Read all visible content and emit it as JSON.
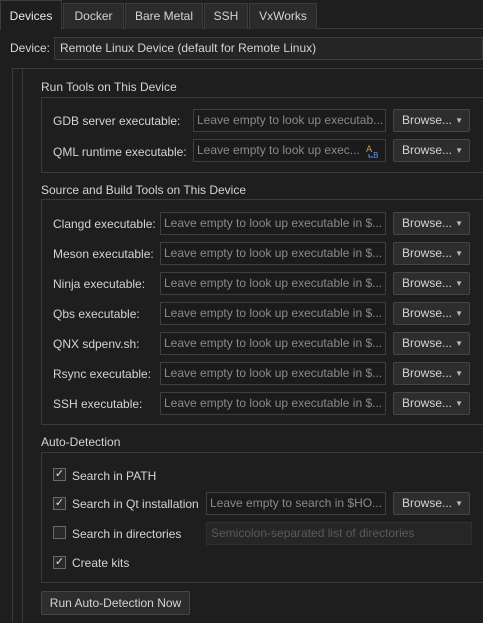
{
  "tabs": [
    {
      "label": "Devices"
    },
    {
      "label": "Docker"
    },
    {
      "label": "Bare Metal"
    },
    {
      "label": "SSH"
    },
    {
      "label": "VxWorks"
    }
  ],
  "device": {
    "label": "Device:",
    "value": "Remote Linux Device (default for Remote Linux)"
  },
  "run_tools": {
    "title": "Run Tools on This Device",
    "rows": [
      {
        "label": "GDB server executable:",
        "placeholder": "Leave empty to look up executab...",
        "browse": "Browse..."
      },
      {
        "label": "QML runtime executable:",
        "placeholder": "Leave empty to look up exec...",
        "browse": "Browse..."
      }
    ]
  },
  "source_tools": {
    "title": "Source and Build Tools on This Device",
    "rows": [
      {
        "label": "Clangd executable:",
        "placeholder": "Leave empty to look up executable in $...",
        "browse": "Browse..."
      },
      {
        "label": "Meson executable:",
        "placeholder": "Leave empty to look up executable in $...",
        "browse": "Browse..."
      },
      {
        "label": "Ninja executable:",
        "placeholder": "Leave empty to look up executable in $...",
        "browse": "Browse..."
      },
      {
        "label": "Qbs executable:",
        "placeholder": "Leave empty to look up executable in $...",
        "browse": "Browse..."
      },
      {
        "label": "QNX sdpenv.sh:",
        "placeholder": "Leave empty to look up executable in $...",
        "browse": "Browse..."
      },
      {
        "label": "Rsync executable:",
        "placeholder": "Leave empty to look up executable in $...",
        "browse": "Browse..."
      },
      {
        "label": "SSH executable:",
        "placeholder": "Leave empty to look up executable in $...",
        "browse": "Browse..."
      }
    ]
  },
  "auto_detection": {
    "title": "Auto-Detection",
    "search_path": {
      "label": "Search in PATH",
      "checked": true
    },
    "search_qt": {
      "label": "Search in Qt installation",
      "checked": true,
      "placeholder": "Leave empty to search in $HO...",
      "browse": "Browse..."
    },
    "search_dirs": {
      "label": "Search in directories",
      "checked": false,
      "placeholder": "Semicolon-separated list of directories"
    },
    "create_kits": {
      "label": "Create kits",
      "checked": true
    },
    "run_button": "Run Auto-Detection Now"
  },
  "icons": {
    "caret": "chevron-down-icon",
    "check": "checkmark-icon",
    "qml": "variable-icon"
  },
  "colors": {
    "background": "#1e1e1e",
    "qml_icon_blue": "#5b8cff",
    "qml_icon_orange": "#d79a43"
  }
}
